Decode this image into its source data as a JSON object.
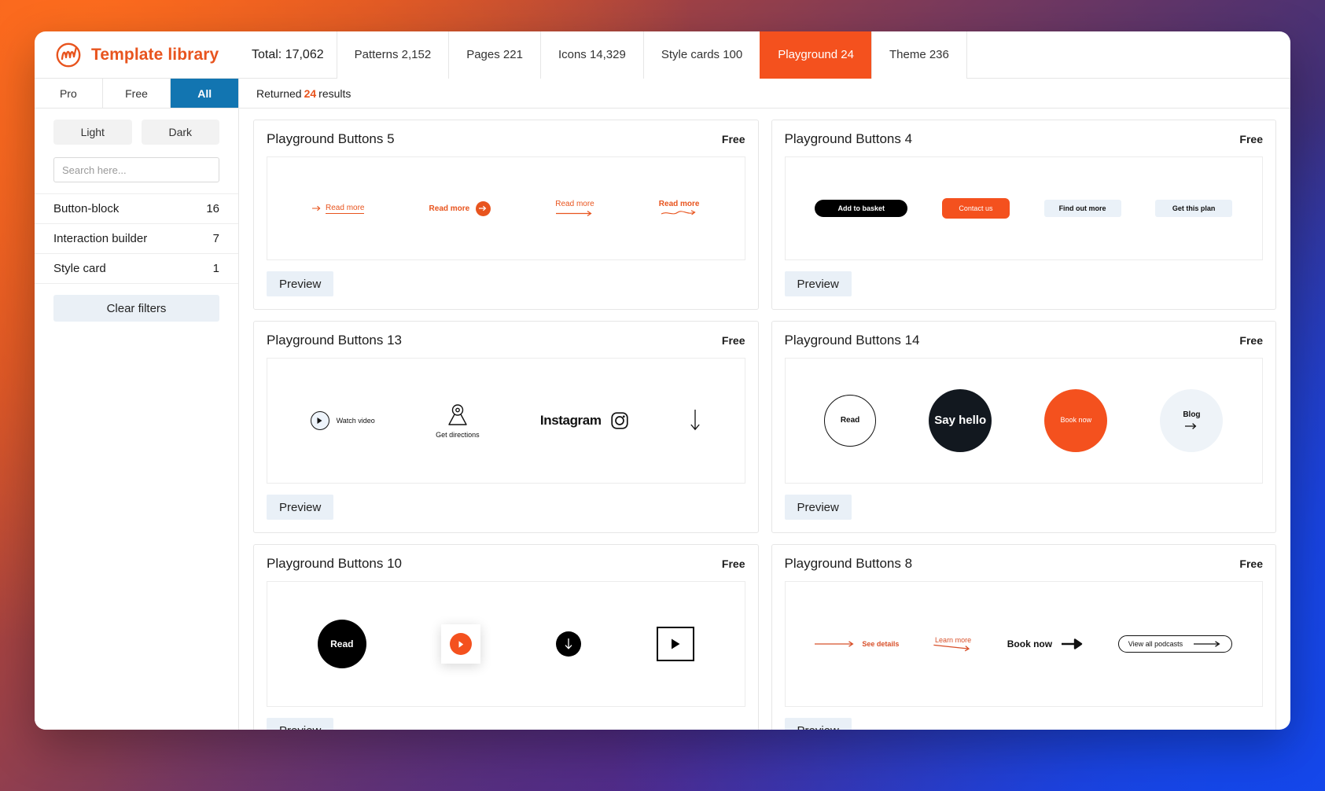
{
  "header": {
    "brand_title": "Template library",
    "logo_icon": "swirl-logo-icon",
    "total_label": "Total: 17,062",
    "tabs": [
      {
        "label": "Patterns 2,152",
        "active": false
      },
      {
        "label": "Pages 221",
        "active": false
      },
      {
        "label": "Icons 14,329",
        "active": false
      },
      {
        "label": "Style cards 100",
        "active": false
      },
      {
        "label": "Playground 24",
        "active": true
      },
      {
        "label": "Theme 236",
        "active": false
      }
    ],
    "accent_color": "#f4511e"
  },
  "sidebar": {
    "segments": [
      {
        "label": "Pro",
        "active": false
      },
      {
        "label": "Free",
        "active": false
      },
      {
        "label": "All",
        "active": true
      }
    ],
    "active_segment_color": "#1275b1",
    "tone_buttons": [
      {
        "label": "Light"
      },
      {
        "label": "Dark"
      }
    ],
    "search": {
      "placeholder": "Search here...",
      "value": ""
    },
    "facets": [
      {
        "label": "Button-block",
        "count": "16"
      },
      {
        "label": "Interaction builder",
        "count": "7"
      },
      {
        "label": "Style card",
        "count": "1"
      }
    ],
    "clear_filters_label": "Clear filters"
  },
  "results": {
    "prefix": "Returned",
    "count": "24",
    "suffix": "results"
  },
  "cards": {
    "preview_label": "Preview",
    "free_label": "Free",
    "left": [
      {
        "title": "Playground Buttons 5",
        "badge": "Free",
        "specimens": [
          {
            "kind": "link-arrow-left",
            "label": "Read more"
          },
          {
            "kind": "link-circle-arrow",
            "label": "Read more"
          },
          {
            "kind": "link-underline-arrow",
            "label": "Read more"
          },
          {
            "kind": "link-scribble-arrow",
            "label": "Read more"
          }
        ]
      },
      {
        "title": "Playground Buttons 13",
        "badge": "Free",
        "specimens": [
          {
            "kind": "play-circle-label",
            "label": "Watch video"
          },
          {
            "kind": "map-pin-label",
            "label": "Get directions"
          },
          {
            "kind": "instagram",
            "label": "Instagram"
          },
          {
            "kind": "arrow-down",
            "label": ""
          }
        ]
      },
      {
        "title": "Playground Buttons 10",
        "badge": "Free",
        "specimens": [
          {
            "kind": "circle-solid",
            "label": "Read"
          },
          {
            "kind": "play-card",
            "label": ""
          },
          {
            "kind": "download-circle",
            "label": ""
          },
          {
            "kind": "play-box",
            "label": ""
          }
        ]
      }
    ],
    "right": [
      {
        "title": "Playground Buttons 4",
        "badge": "Free",
        "specimens": [
          {
            "kind": "pill-black",
            "label": "Add to basket"
          },
          {
            "kind": "pill-orange",
            "label": "Contact us"
          },
          {
            "kind": "pill-pale",
            "label": "Find out more"
          },
          {
            "kind": "pill-pale",
            "label": "Get this plan"
          }
        ]
      },
      {
        "title": "Playground Buttons 14",
        "badge": "Free",
        "specimens": [
          {
            "kind": "circle-outline",
            "label": "Read"
          },
          {
            "kind": "circle-dark",
            "label": "Say hello"
          },
          {
            "kind": "circle-orange",
            "label": "Book now"
          },
          {
            "kind": "circle-pale",
            "label": "Blog"
          }
        ]
      },
      {
        "title": "Playground Buttons 8",
        "badge": "Free",
        "specimens": [
          {
            "kind": "arrow-then-text",
            "label": "See details"
          },
          {
            "kind": "text-over-arrow",
            "label": "Learn more"
          },
          {
            "kind": "text-bold-arrow",
            "label": "Book now"
          },
          {
            "kind": "outline-pill-arrow",
            "label": "View all podcasts"
          }
        ]
      }
    ]
  },
  "colors": {
    "brand_orange": "#e8541e",
    "tab_active": "#f4511e",
    "segment_active_blue": "#1275b1",
    "preview_bg": "#e9f0f7",
    "canvas_border": "#ececec"
  }
}
